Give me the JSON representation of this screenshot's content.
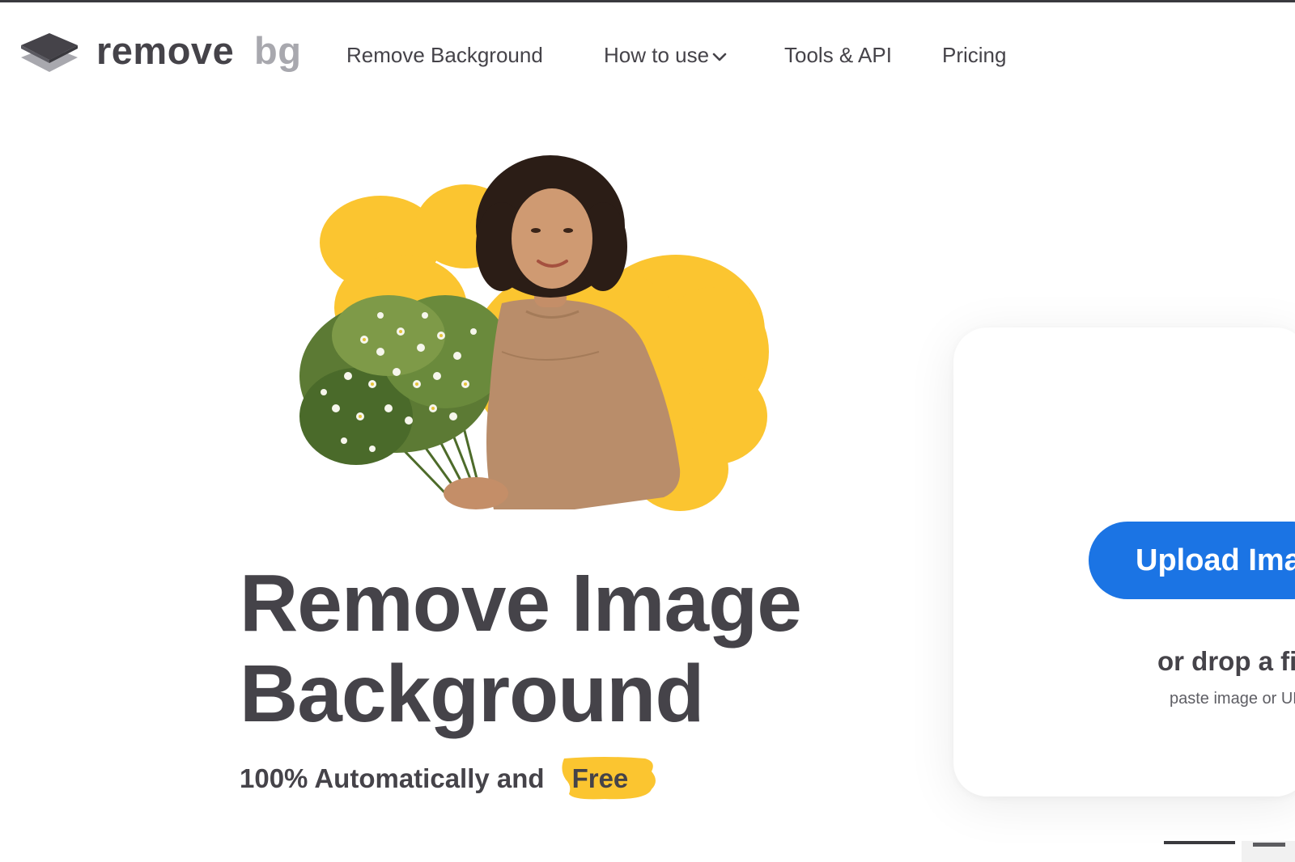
{
  "header": {
    "logo": {
      "word_primary": "remove",
      "word_secondary": "bg",
      "icon": "stacked-layers-icon"
    },
    "nav": [
      {
        "label": "Remove Background"
      },
      {
        "label": "How to use",
        "icon": "chevron-down-icon"
      },
      {
        "label": "Tools & API"
      },
      {
        "label": "Pricing"
      }
    ]
  },
  "hero": {
    "title_line1": "Remove Image",
    "title_line2": "Background",
    "subtitle": "100% Automatically and",
    "highlight": "Free",
    "image": "woman-holding-flower-bouquet-cutout"
  },
  "upload": {
    "button_label": "Upload Image",
    "drop_text": "or drop a file,",
    "paste_text": "paste image or URL"
  },
  "colors": {
    "text": "#454349",
    "logo_secondary": "#a8a8ae",
    "accent_blue": "#1b74e4",
    "accent_yellow": "#fbc530",
    "top_rule": "#3a3a3e"
  }
}
